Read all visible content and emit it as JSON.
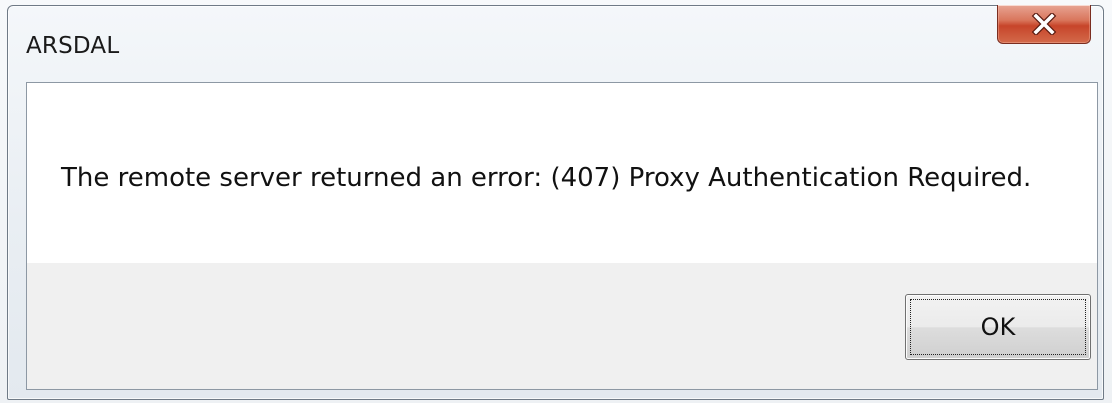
{
  "window": {
    "title": "ARSDAL"
  },
  "dialog": {
    "message": "The remote server returned an error: (407) Proxy Authentication Required.",
    "ok_label": "OK"
  },
  "icons": {
    "close": "close-icon"
  },
  "colors": {
    "close_button": "#c7452a",
    "content_background": "#ffffff",
    "button_area_background": "#f0f0f0"
  }
}
